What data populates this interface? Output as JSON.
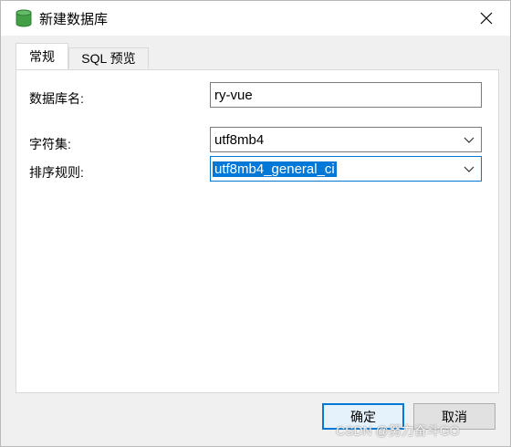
{
  "window": {
    "title": "新建数据库",
    "icon": "database-icon"
  },
  "tabs": [
    {
      "label": "常规",
      "active": true
    },
    {
      "label": "SQL 预览",
      "active": false
    }
  ],
  "form": {
    "db_name_label": "数据库名:",
    "db_name_value": "ry-vue",
    "charset_label": "字符集:",
    "charset_value": "utf8mb4",
    "collation_label": "排序规则:",
    "collation_value": "utf8mb4_general_ci"
  },
  "buttons": {
    "ok": "确定",
    "cancel": "取消"
  },
  "watermark": "CSDN @努力奋斗GO",
  "colors": {
    "accent": "#0078d7",
    "db_icon": "#3a9b3a"
  }
}
